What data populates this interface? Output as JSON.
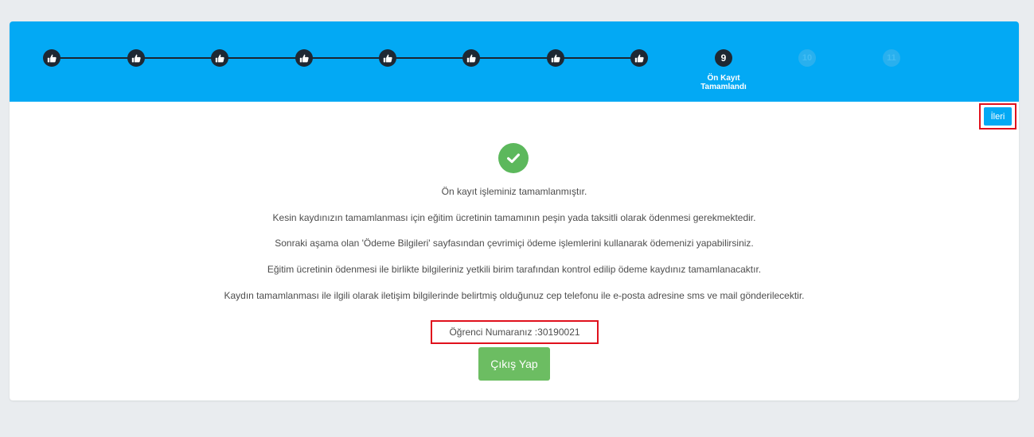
{
  "colors": {
    "page_bg": "#e9ecef",
    "stepper_bg": "#03a9f4",
    "step_done": "#1e2833",
    "success": "#5cb85c",
    "logout_bg": "#6cbd62",
    "highlight": "#e0101c"
  },
  "stepper": {
    "completed_icon": "thumbs-up-icon",
    "steps": [
      {
        "status": "done"
      },
      {
        "status": "done"
      },
      {
        "status": "done"
      },
      {
        "status": "done"
      },
      {
        "status": "done"
      },
      {
        "status": "done"
      },
      {
        "status": "done"
      },
      {
        "status": "done"
      },
      {
        "status": "active",
        "number": "9",
        "label_line1": "Ön Kayıt",
        "label_line2": "Tamamlandı"
      },
      {
        "status": "pending",
        "number": "10"
      },
      {
        "status": "pending",
        "number": "11"
      }
    ]
  },
  "actions": {
    "next_label": "İleri",
    "logout_label": "Çıkış Yap"
  },
  "main": {
    "success_icon": "check-circle-icon",
    "messages": [
      "Ön kayıt işleminiz tamamlanmıştır.",
      "Kesin kaydınızın tamamlanması için eğitim ücretinin tamamının peşin yada taksitli olarak ödenmesi gerekmektedir.",
      "Sonraki aşama olan 'Ödeme Bilgileri' sayfasından çevrimiçi ödeme işlemlerini kullanarak ödemenizi yapabilirsiniz.",
      "Eğitim ücretinin ödenmesi ile birlikte bilgileriniz yetkili birim tarafından kontrol edilip ödeme kaydınız tamamlanacaktır.",
      "Kaydın tamamlanması ile ilgili olarak iletişim bilgilerinde belirtmiş olduğunuz cep telefonu ile e-posta adresine sms ve mail gönderilecektir."
    ],
    "student_number_text": "Öğrenci Numaranız :30190021"
  }
}
